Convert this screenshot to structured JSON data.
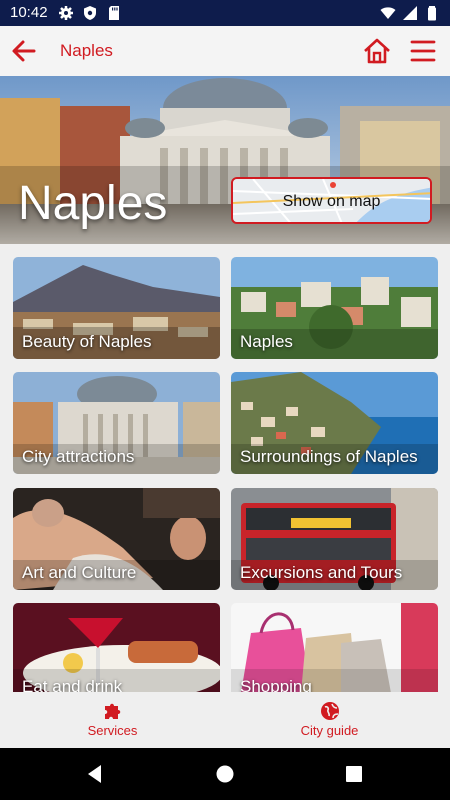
{
  "status_bar": {
    "time": "10:42",
    "left_icons": [
      "gear-icon",
      "shield-icon",
      "sd-card-icon"
    ],
    "right_icons": [
      "wifi-icon",
      "signal-icon",
      "battery-icon"
    ]
  },
  "app_bar": {
    "title": "Naples",
    "back_icon": "arrow-left-icon",
    "home_icon": "home-icon",
    "menu_icon": "hamburger-icon",
    "accent": "#d11b21"
  },
  "hero": {
    "title": "Naples",
    "map_button_label": "Show on map"
  },
  "tiles": [
    {
      "label": "Beauty of Naples"
    },
    {
      "label": "Naples"
    },
    {
      "label": "City attractions"
    },
    {
      "label": "Surroundings of Naples"
    },
    {
      "label": "Art and Culture"
    },
    {
      "label": "Excursions and Tours"
    },
    {
      "label": "Eat and drink"
    },
    {
      "label": "Shopping"
    }
  ],
  "bottom_nav": {
    "items": [
      {
        "label": "Services",
        "icon": "puzzle-icon"
      },
      {
        "label": "City guide",
        "icon": "globe-icon"
      }
    ]
  },
  "system_nav": [
    "back-triangle-icon",
    "home-circle-icon",
    "recents-square-icon"
  ]
}
